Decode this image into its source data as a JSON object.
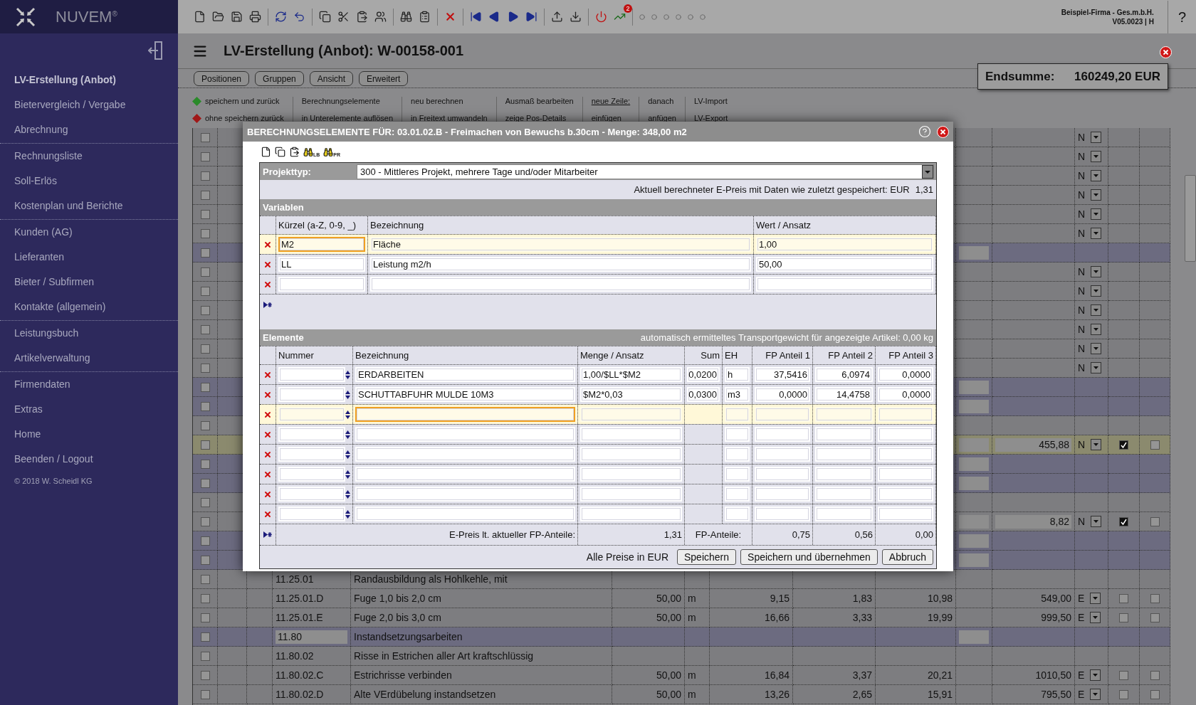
{
  "sidebar": {
    "brand": "NUVEM$^{®}$",
    "groups": [
      [
        {
          "label": "LV-Erstellung (Anbot)",
          "selected": true
        },
        {
          "label": "Bietervergleich / Vergabe",
          "selected": false
        },
        {
          "label": "Abrechnung",
          "selected": false
        }
      ],
      [
        {
          "label": "Rechnungsliste",
          "selected": false
        },
        {
          "label": "Soll-Erlös",
          "selected": false
        },
        {
          "label": "Kostenplan und Berichte",
          "selected": false
        }
      ],
      [
        {
          "label": "Kunden (AG)",
          "selected": false
        },
        {
          "label": "Lieferanten",
          "selected": false
        },
        {
          "label": "Bieter / Subfirmen",
          "selected": false
        },
        {
          "label": "Kontakte (allgemein)",
          "selected": false
        }
      ],
      [
        {
          "label": "Leistungsbuch",
          "selected": false
        },
        {
          "label": "Artikelverwaltung",
          "selected": false
        }
      ],
      [
        {
          "label": "Firmendaten",
          "selected": false
        },
        {
          "label": "Extras",
          "selected": false
        },
        {
          "label": "Home",
          "selected": false
        },
        {
          "label": "Beenden / Logout",
          "selected": false
        }
      ]
    ],
    "copyright": "© 2018 W. Scheidl KG"
  },
  "toolbar": {
    "badge": "2",
    "company": "Beispiel-Firma - Ges.m.b.H.",
    "version": "V05.0023 | H",
    "help": "?"
  },
  "header": {
    "title": "LV-Erstellung (Anbot): W-00158-001",
    "total_label": "Endsumme:",
    "total_value": "160249,20 EUR"
  },
  "tabs": [
    "Positionen",
    "Gruppen",
    "Ansicht",
    "Erweitert"
  ],
  "actions": [
    [
      {
        "label": "speichern und zurück",
        "kind": "save"
      },
      {
        "label": "ohne speichern zurück",
        "kind": "discard"
      }
    ],
    [
      {
        "label": "Berechnungselemente",
        "kind": "plain"
      },
      {
        "label": "in Unterelemente auflösen",
        "kind": "plain"
      }
    ],
    [
      {
        "label": "neu berechnen",
        "kind": "plain"
      },
      {
        "label": "in Freitext umwandeln",
        "kind": "plain"
      }
    ],
    [
      {
        "label": "Ausmaß bearbeiten",
        "kind": "plain"
      },
      {
        "label": "zeige Pos-Details",
        "kind": "plain"
      }
    ],
    [
      {
        "label": "neue Zeile:",
        "kind": "underlined"
      },
      {
        "label": "einfügen",
        "kind": "plain"
      }
    ],
    [
      {
        "label": "danach",
        "kind": "plain"
      },
      {
        "label": "anfügen",
        "kind": "plain"
      }
    ],
    [
      {
        "label": "LV-Import",
        "kind": "plain"
      },
      {
        "label": "LV-Export",
        "kind": "plain"
      }
    ]
  ],
  "table": {
    "rows": [
      {
        "kind": "position",
        "selected": false,
        "checked": false,
        "column_13": "N"
      },
      {
        "kind": "position",
        "selected": false,
        "checked": false,
        "column_13": "N"
      },
      {
        "kind": "position",
        "selected": false,
        "checked": false,
        "column_13": "N"
      },
      {
        "kind": "position",
        "selected": false,
        "checked": false,
        "column_13": "N"
      },
      {
        "kind": "position",
        "selected": false,
        "checked": false,
        "column_13": "N"
      },
      {
        "kind": "position",
        "selected": false,
        "checked": false,
        "column_13": "N"
      },
      {
        "kind": "group",
        "selected": false,
        "checked": false
      },
      {
        "kind": "position",
        "selected": false,
        "checked": false,
        "column_13": "N"
      },
      {
        "kind": "position",
        "selected": false,
        "checked": false,
        "column_13": "N"
      },
      {
        "kind": "position",
        "selected": false,
        "checked": false,
        "column_13": "N"
      },
      {
        "kind": "position",
        "selected": false,
        "checked": false,
        "column_13": "N"
      },
      {
        "kind": "position",
        "selected": false,
        "checked": false,
        "column_13": "N"
      },
      {
        "kind": "position",
        "selected": false,
        "checked": false,
        "column_13": "N"
      },
      {
        "kind": "group",
        "selected": false,
        "checked": false
      },
      {
        "kind": "group",
        "selected": false,
        "checked": false
      },
      {
        "kind": "position",
        "selected": false,
        "checked": false
      },
      {
        "kind": "entry",
        "selected": true,
        "checked": false,
        "column_12": "455,88",
        "column_13": "N",
        "column_14_checked": true,
        "column_15_checked": false
      },
      {
        "kind": "group",
        "selected": false,
        "checked": false
      },
      {
        "kind": "group",
        "selected": false,
        "checked": false
      },
      {
        "kind": "position",
        "selected": false,
        "checked": false
      },
      {
        "kind": "entry",
        "selected": false,
        "checked": false,
        "column_12": "8,82",
        "column_13": "N",
        "column_14_checked": true,
        "column_15_checked": false
      },
      {
        "kind": "group",
        "selected": false,
        "checked": false
      },
      {
        "kind": "group",
        "selected": false,
        "checked": false
      },
      {
        "kind": "position",
        "selected": false,
        "checked": false,
        "column_4": "11.25.01",
        "column_5": "Randausbildung als Hohlkehle, mit"
      },
      {
        "kind": "position",
        "selected": false,
        "checked": false,
        "column_4": "11.25.01.D",
        "column_5": "Fuge 1,0 bis 2,0 cm",
        "column_6": "50,00",
        "column_7": "m",
        "column_8": "9,15",
        "column_9": "1,83",
        "column_10": "10,98",
        "column_12": "549,00",
        "column_13": "E",
        "column_14_checked": false,
        "column_15_checked": false
      },
      {
        "kind": "position",
        "selected": false,
        "checked": false,
        "column_4": "11.25.01.E",
        "column_5": "Fuge 2,0 bis 3,0 cm",
        "column_6": "50,00",
        "column_7": "m",
        "column_8": "16,66",
        "column_9": "3,33",
        "column_10": "19,99",
        "column_12": "999,50",
        "column_13": "E",
        "column_14_checked": false,
        "column_15_checked": false
      },
      {
        "kind": "group",
        "selected": false,
        "checked": false,
        "column_4": "11.80",
        "column_5": "Instandsetzungsarbeiten"
      },
      {
        "kind": "position",
        "selected": false,
        "checked": false,
        "column_4": "11.80.02",
        "column_5": "Risse in Estrichen aller Art kraftschlüssig"
      },
      {
        "kind": "position",
        "selected": false,
        "checked": false,
        "column_4": "11.80.02.C",
        "column_5": "Estrichrisse verbinden",
        "column_6": "50,00",
        "column_7": "m",
        "column_8": "16,84",
        "column_9": "3,37",
        "column_10": "20,21",
        "column_12": "1010,50",
        "column_13": "E",
        "column_14_checked": false,
        "column_15_checked": false
      },
      {
        "kind": "position",
        "selected": false,
        "checked": false,
        "column_4": "11.80.02.D",
        "column_5": "Alte VErdübelung instandsetzen",
        "column_6": "50,00",
        "column_7": "m",
        "column_8": "13,26",
        "column_9": "2,65",
        "column_10": "15,91",
        "column_12": "795,50",
        "column_13": "E",
        "column_14_checked": false,
        "column_15_checked": false
      }
    ]
  },
  "dialog": {
    "title": "BERECHNUNGSELEMENTE FÜR: 03.01.02.B - Freimachen von Bewuchs b.30cm - Menge: 348,00 m2",
    "icon_labels": [
      "LB",
      "PR"
    ],
    "project_type": {
      "label": "Projekttyp:",
      "value": "300 - Mittleres Projekt, mehrere Tage und/oder Mitarbeiter"
    },
    "price_info": {
      "label": "Aktuell berechneter E-Preis mit Daten wie zuletzt gespeichert: EUR",
      "value": "1,31"
    },
    "variables": {
      "title": "Variablen",
      "columns": [
        {
          "label": "Kürzel (a-Z, 0-9, _)",
          "kind": "text"
        },
        {
          "label": "Bezeichnung",
          "kind": "text"
        },
        {
          "label": "Wert / Ansatz",
          "kind": "text"
        }
      ],
      "rows": [
        {
          "selected": true,
          "cells": [
            {
              "text": "M2",
              "focused": true
            },
            {
              "text": "Fläche",
              "focused": false
            },
            {
              "text": "1,00",
              "focused": false
            }
          ]
        },
        {
          "selected": false,
          "cells": [
            {
              "text": "LL",
              "focused": false
            },
            {
              "text": "Leistung m2/h",
              "focused": false
            },
            {
              "text": "50,00",
              "focused": false
            }
          ]
        },
        {
          "selected": false,
          "cells": [
            {
              "focused": false
            },
            {
              "focused": false
            },
            {
              "focused": false
            }
          ]
        }
      ]
    },
    "elements": {
      "title": "Elemente",
      "note": "automatisch ermitteltes Transportgewicht für angezeigte Artikel: 0,00 kg",
      "columns": [
        {
          "label": "Nummer",
          "kind": "spinner"
        },
        {
          "label": "Bezeichnung",
          "kind": "text"
        },
        {
          "label": "Menge / Ansatz",
          "kind": "text"
        },
        {
          "label": "Sum",
          "kind": "computed"
        },
        {
          "label": "EH",
          "kind": "text"
        },
        {
          "label": "FP Anteil 1",
          "kind": "number"
        },
        {
          "label": "FP Anteil 2",
          "kind": "number"
        },
        {
          "label": "FP Anteil 3",
          "kind": "number"
        }
      ],
      "rows": [
        {
          "selected": false,
          "cells": [
            {
              "focused": false
            },
            {
              "text": "ERDARBEITEN",
              "focused": false
            },
            {
              "text": "1,00/$LL*$M2",
              "focused": false
            },
            {
              "text": "0,0200",
              "focused": false
            },
            {
              "text": "h",
              "focused": false
            },
            {
              "text": "37,5416",
              "focused": false
            },
            {
              "text": "6,0974",
              "focused": false
            },
            {
              "text": "0,0000",
              "focused": false
            }
          ]
        },
        {
          "selected": false,
          "cells": [
            {
              "focused": false
            },
            {
              "text": "SCHUTTABFUHR MULDE 10M3",
              "focused": false
            },
            {
              "text": "$M2*0,03",
              "focused": false
            },
            {
              "text": "0,0300",
              "focused": false
            },
            {
              "text": "m3",
              "focused": false
            },
            {
              "text": "0,0000",
              "focused": false
            },
            {
              "text": "14,4758",
              "focused": false
            },
            {
              "text": "0,0000",
              "focused": false
            }
          ]
        },
        {
          "selected": true,
          "cells": [
            {
              "focused": false
            },
            {
              "focused": true
            },
            {
              "focused": false
            },
            {
              "focused": false
            },
            {
              "focused": false
            },
            {
              "focused": false
            },
            {
              "focused": false
            },
            {
              "focused": false
            }
          ]
        },
        {
          "selected": false,
          "cells": [
            {
              "focused": false
            },
            {
              "focused": false
            },
            {
              "focused": false
            },
            {
              "focused": false
            },
            {
              "focused": false
            },
            {
              "focused": false
            },
            {
              "focused": false
            },
            {
              "focused": false
            }
          ]
        },
        {
          "selected": false,
          "cells": [
            {
              "focused": false
            },
            {
              "focused": false
            },
            {
              "focused": false
            },
            {
              "focused": false
            },
            {
              "focused": false
            },
            {
              "focused": false
            },
            {
              "focused": false
            },
            {
              "focused": false
            }
          ]
        },
        {
          "selected": false,
          "cells": [
            {
              "focused": false
            },
            {
              "focused": false
            },
            {
              "focused": false
            },
            {
              "focused": false
            },
            {
              "focused": false
            },
            {
              "focused": false
            },
            {
              "focused": false
            },
            {
              "focused": false
            }
          ]
        },
        {
          "selected": false,
          "cells": [
            {
              "focused": false
            },
            {
              "focused": false
            },
            {
              "focused": false
            },
            {
              "focused": false
            },
            {
              "focused": false
            },
            {
              "focused": false
            },
            {
              "focused": false
            },
            {
              "focused": false
            }
          ]
        },
        {
          "selected": false,
          "cells": [
            {
              "focused": false
            },
            {
              "focused": false
            },
            {
              "focused": false
            },
            {
              "focused": false
            },
            {
              "focused": false
            },
            {
              "focused": false
            },
            {
              "focused": false
            },
            {
              "focused": false
            }
          ]
        }
      ],
      "footer": {
        "label": "E-Preis lt. aktueller FP-Anteile:",
        "value": "1,31",
        "shares_label": "FP-Anteile:",
        "shares": [
          "0,75",
          "0,56",
          "0,00"
        ]
      }
    },
    "currency_note": "Alle Preise in EUR",
    "buttons": [
      "Speichern",
      "Speichern und übernehmen",
      "Abbruch"
    ]
  }
}
